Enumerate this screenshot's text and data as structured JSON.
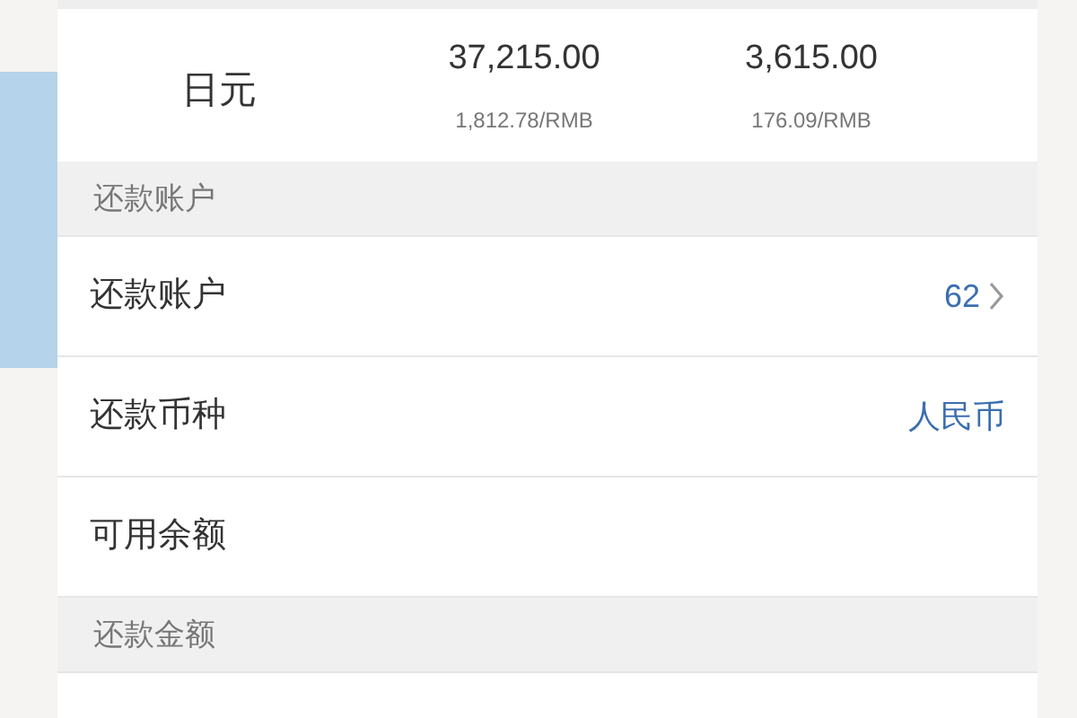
{
  "currency_row": {
    "currency": "日元",
    "amounts": [
      {
        "value": "37,215.00",
        "converted": "1,812.78/RMB"
      },
      {
        "value": "3,615.00",
        "converted": "176.09/RMB"
      }
    ]
  },
  "sections": [
    {
      "header": "还款账户",
      "rows": [
        {
          "label": "还款账户",
          "value": "62",
          "kind": "link"
        },
        {
          "label": "还款币种",
          "value": "人民币",
          "kind": "text"
        },
        {
          "label": "可用余额",
          "kind": "empty"
        }
      ]
    },
    {
      "header": "还款金额"
    }
  ]
}
